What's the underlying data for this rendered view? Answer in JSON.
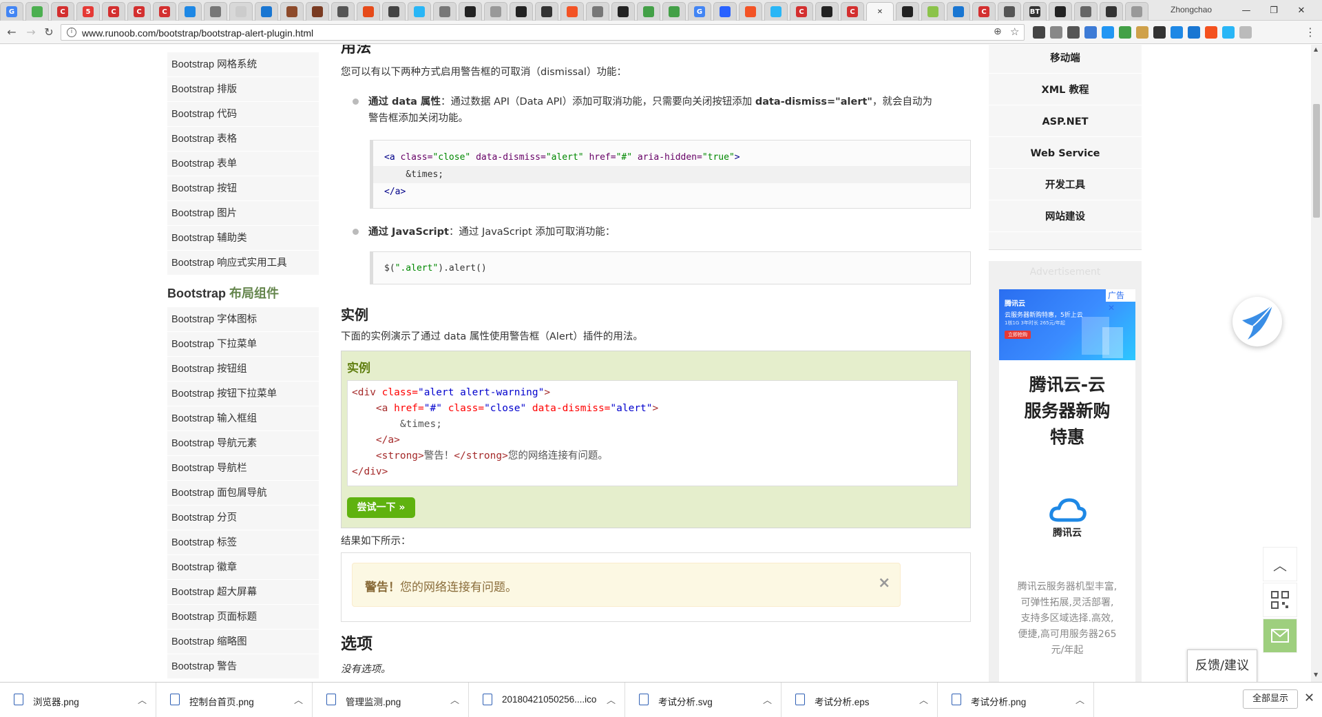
{
  "browser": {
    "profile_name": "Zhongchao",
    "url": "www.runoob.com/bootstrap/bootstrap-alert-plugin.html",
    "tab_favicons": [
      {
        "icon": "google-icon",
        "color": "#4285f4",
        "label": "G"
      },
      {
        "icon": "tab-icon",
        "color": "#4caf50",
        "label": ""
      },
      {
        "icon": "c-icon",
        "color": "#d32f2f",
        "label": "C"
      },
      {
        "icon": "five-icon",
        "color": "#e53935",
        "label": "5"
      },
      {
        "icon": "c-icon",
        "color": "#d32f2f",
        "label": "C"
      },
      {
        "icon": "c-icon",
        "color": "#d32f2f",
        "label": "C"
      },
      {
        "icon": "c-icon",
        "color": "#d32f2f",
        "label": "C"
      },
      {
        "icon": "chart-icon",
        "color": "#1e88e5",
        "label": ""
      },
      {
        "icon": "mushroom-icon",
        "color": "#777777",
        "label": ""
      },
      {
        "icon": "blank-icon",
        "color": "#cccccc",
        "label": ""
      },
      {
        "icon": "edit-icon",
        "color": "#1976d2",
        "label": ""
      },
      {
        "icon": "photo-icon",
        "color": "#8d4a2a",
        "label": ""
      },
      {
        "icon": "photo-icon",
        "color": "#7a3b22",
        "label": ""
      },
      {
        "icon": "person-icon",
        "color": "#555555",
        "label": ""
      },
      {
        "icon": "plus-icon",
        "color": "#e64a19",
        "label": ""
      },
      {
        "icon": "link-icon",
        "color": "#444444",
        "label": ""
      },
      {
        "icon": "cloud-icon",
        "color": "#29b6f6",
        "label": ""
      },
      {
        "icon": "mushroom-icon",
        "color": "#777777",
        "label": ""
      },
      {
        "icon": "github-icon",
        "color": "#222222",
        "label": ""
      },
      {
        "icon": "doc-icon",
        "color": "#999999",
        "label": ""
      },
      {
        "icon": "github-icon",
        "color": "#222222",
        "label": ""
      },
      {
        "icon": "feather-icon",
        "color": "#333333",
        "label": ""
      },
      {
        "icon": "windows-icon",
        "color": "#f35325",
        "label": ""
      },
      {
        "icon": "mushroom-icon",
        "color": "#777777",
        "label": ""
      },
      {
        "icon": "github-icon",
        "color": "#222222",
        "label": ""
      },
      {
        "icon": "play-icon",
        "color": "#43a047",
        "label": ""
      },
      {
        "icon": "play-icon",
        "color": "#43a047",
        "label": ""
      },
      {
        "icon": "google-icon",
        "color": "#4285f4",
        "label": "G"
      },
      {
        "icon": "paw-icon",
        "color": "#2962ff",
        "label": ""
      },
      {
        "icon": "windows-icon",
        "color": "#f35325",
        "label": ""
      },
      {
        "icon": "cloud-icon",
        "color": "#29b6f6",
        "label": ""
      },
      {
        "icon": "c-icon",
        "color": "#d32f2f",
        "label": "C"
      },
      {
        "icon": "github-icon",
        "color": "#222222",
        "label": ""
      },
      {
        "icon": "c-icon",
        "color": "#d32f2f",
        "label": "C"
      },
      {
        "icon": "close-icon",
        "color": "#f7f7f7",
        "label": "✕"
      },
      {
        "icon": "github-icon",
        "color": "#222222",
        "label": ""
      },
      {
        "icon": "android-icon",
        "color": "#8bc34a",
        "label": ""
      },
      {
        "icon": "arrow-icon",
        "color": "#1976d2",
        "label": ""
      },
      {
        "icon": "c-icon",
        "color": "#d32f2f",
        "label": "C"
      },
      {
        "icon": "media-icon",
        "color": "#555555",
        "label": ""
      },
      {
        "icon": "bt-icon",
        "color": "#333333",
        "label": "BT"
      },
      {
        "icon": "github-icon",
        "color": "#222222",
        "label": ""
      },
      {
        "icon": "download-icon",
        "color": "#666666",
        "label": ""
      },
      {
        "icon": "terminal-icon",
        "color": "#333333",
        "label": ""
      },
      {
        "icon": "doc-icon",
        "color": "#999999",
        "label": ""
      }
    ],
    "extension_colors": [
      "#444444",
      "#888888",
      "#555555",
      "#3d7bd6",
      "#2196f3",
      "#43a047",
      "#cfa14a",
      "#333333",
      "#1e88e5",
      "#1976d2",
      "#f4511e",
      "#29b6f6",
      "#bbbbbb"
    ]
  },
  "sidebar": {
    "group1": [
      "Bootstrap 网格系统",
      "Bootstrap 排版",
      "Bootstrap 代码",
      "Bootstrap 表格",
      "Bootstrap 表单",
      "Bootstrap 按钮",
      "Bootstrap 图片",
      "Bootstrap 辅助类",
      "Bootstrap 响应式实用工具"
    ],
    "heading_prefix": "Bootstrap ",
    "heading_accent": "布局组件",
    "group2": [
      "Bootstrap 字体图标",
      "Bootstrap 下拉菜单",
      "Bootstrap 按钮组",
      "Bootstrap 按钮下拉菜单",
      "Bootstrap 输入框组",
      "Bootstrap 导航元素",
      "Bootstrap 导航栏",
      "Bootstrap 面包屑导航",
      "Bootstrap 分页",
      "Bootstrap 标签",
      "Bootstrap 徽章",
      "Bootstrap 超大屏幕",
      "Bootstrap 页面标题",
      "Bootstrap 缩略图",
      "Bootstrap 警告"
    ]
  },
  "main": {
    "cut_heading": "用法",
    "intro": "您可以有以下两种方式启用警告框的可取消（dismissal）功能：",
    "bullet1_bold": "通过 data 属性",
    "bullet1_text": "：通过数据 API（Data API）添加可取消功能，只需要向关闭按钮添加 ",
    "bullet1_code": "data-dismiss=\"alert\"",
    "bullet1_tail": "，就会自动为",
    "bullet1_line2": "警告框添加关闭功能。",
    "code1": {
      "l1_tag_open": "<a ",
      "l1_a1": "class=",
      "l1_v1": "\"close\"",
      "l1_a2": " data-dismiss=",
      "l1_v2": "\"alert\"",
      "l1_a3": " href=",
      "l1_v3": "\"#\"",
      "l1_a4": " aria-hidden=",
      "l1_v4": "\"true\"",
      "l1_tag_close": ">",
      "l2": "    &times;",
      "l3": "</a>"
    },
    "bullet2_bold": "通过 JavaScript",
    "bullet2_text": "：通过 JavaScript 添加可取消功能：",
    "code2_func": "$(",
    "code2_str": "\".alert\"",
    "code2_rest": ").alert()",
    "example_heading": "实例",
    "example_intro": "下面的实例演示了通过 data 属性使用警告框（Alert）插件的用法。",
    "example_box_title": "实例",
    "example_code": {
      "l1_t": "<div ",
      "l1_a": "class=",
      "l1_v": "\"alert alert-warning\"",
      "l1_e": ">",
      "l2_t": "    <a ",
      "l2_a1": "href=",
      "l2_v1": "\"#\"",
      "l2_a2": " class=",
      "l2_v2": "\"close\"",
      "l2_a3": " data-dismiss=",
      "l2_v3": "\"alert\"",
      "l2_e": ">",
      "l3": "        &times;",
      "l4": "    </a>",
      "l5_t1": "    <strong>",
      "l5_x1": "警告！",
      "l5_t2": "</strong>",
      "l5_x2": "您的网络连接有问题。",
      "l6": "</div>"
    },
    "try_button": "尝试一下 »",
    "result_label": "结果如下所示：",
    "alert_strong": "警告！",
    "alert_text": "您的网络连接有问题。",
    "alert_close": "×",
    "options_heading": "选项",
    "options_text": "没有选项。"
  },
  "right_nav": {
    "items": [
      "移动端",
      "XML 教程",
      "ASP.NET",
      "Web Service",
      "开发工具",
      "网站建设"
    ]
  },
  "ad": {
    "label": "Advertisement",
    "badge": "广告",
    "banner_brand": "腾讯云",
    "banner_line1": "云服务器新购特惠，5折上云",
    "banner_line2": "1核1G 3年时长 265元/年起",
    "banner_button": "立即抢购",
    "title_lines": [
      "腾讯云-云",
      "服务器新购",
      "特惠"
    ],
    "logo_text": "腾讯云",
    "desc_lines": [
      "腾讯云服务器机型丰富,",
      "可弹性拓展,灵活部署,",
      "支持多区域选择.高效,",
      "便捷,高可用服务器265",
      "元/年起"
    ]
  },
  "floating": {
    "feedback": "反馈/建议"
  },
  "downloads": {
    "files": [
      "浏览器.png",
      "控制台首页.png",
      "管理监测.png",
      "20180421050256....ico",
      "考试分析.svg",
      "考试分析.eps",
      "考试分析.png"
    ],
    "show_all": "全部显示"
  }
}
